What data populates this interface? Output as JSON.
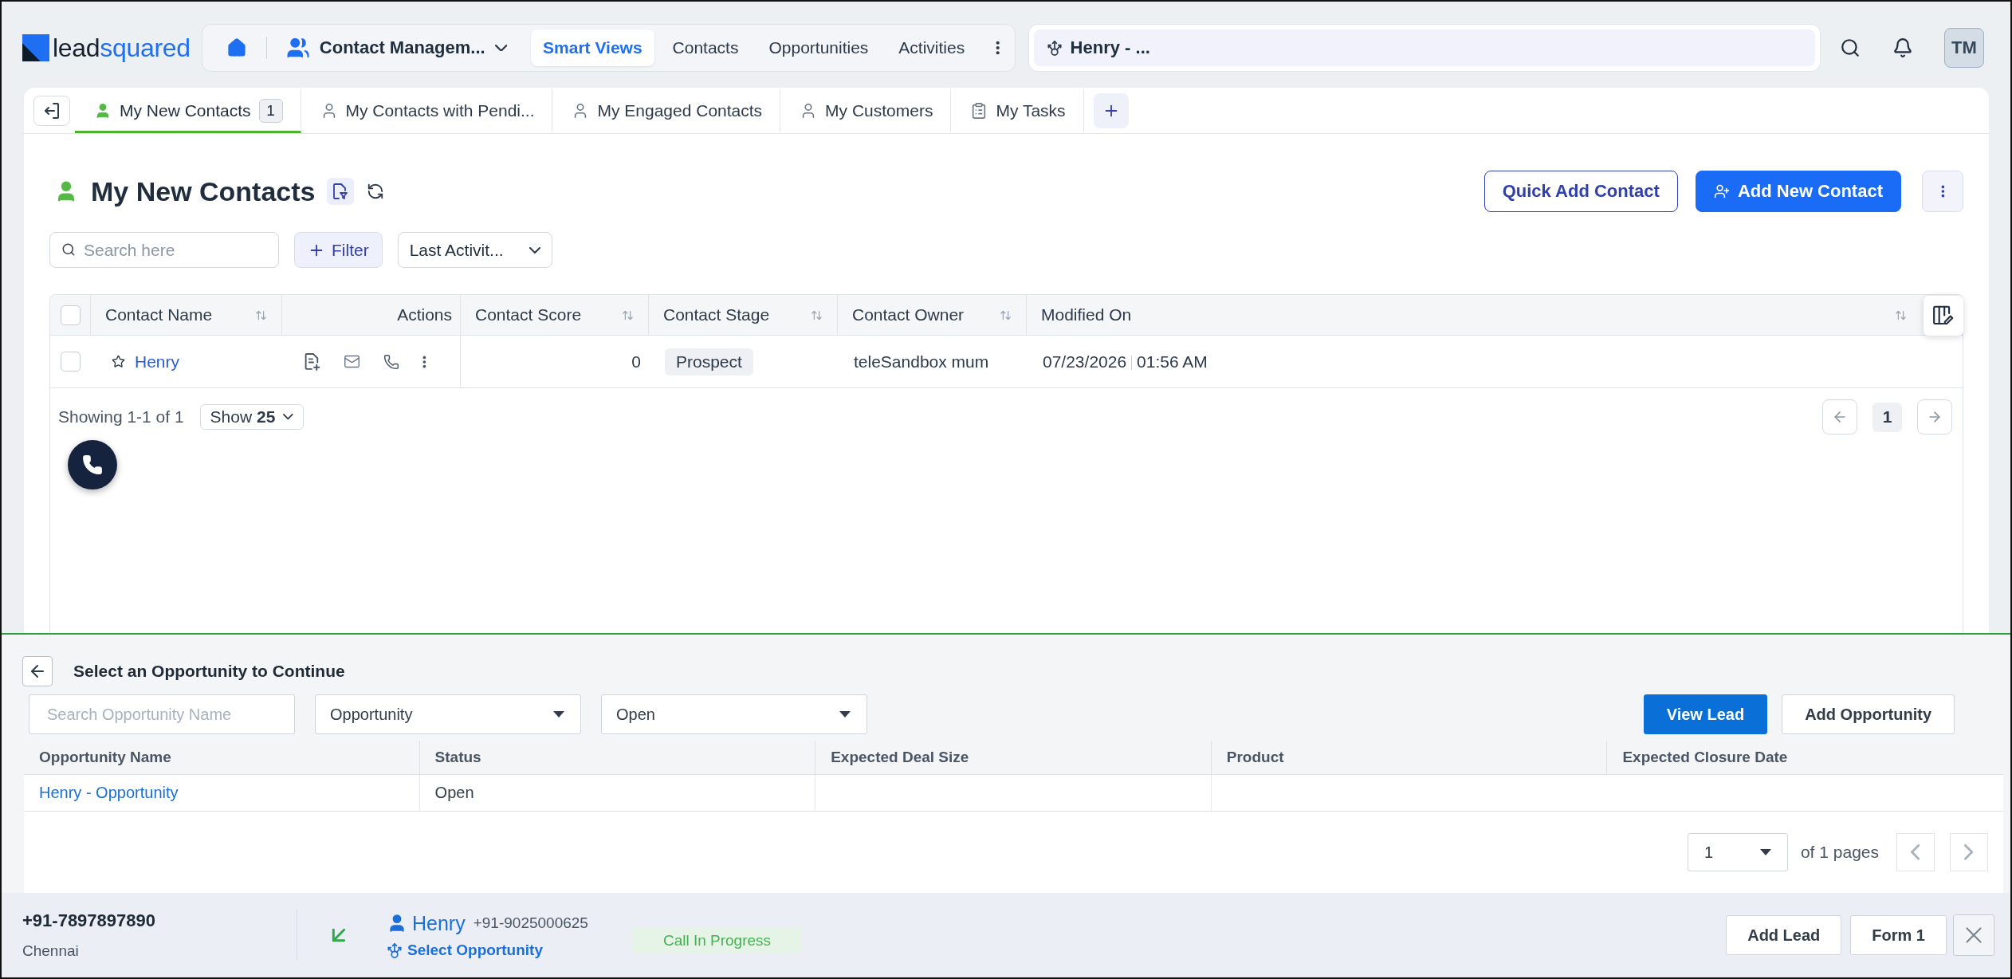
{
  "top_bar": {
    "logo": [
      "lead",
      "squared"
    ],
    "app_switcher": "Contact Managem...",
    "nav": [
      {
        "label": "Smart Views",
        "selected": true
      },
      {
        "label": "Contacts",
        "selected": false
      },
      {
        "label": "Opportunities",
        "selected": false
      },
      {
        "label": "Activities",
        "selected": false
      }
    ],
    "record_field": "Henry - ...",
    "avatar": "TM"
  },
  "tabs": {
    "items": [
      {
        "label": "My New Contacts",
        "count": "1",
        "kind": "contacts",
        "selected": true
      },
      {
        "label": "My Contacts with Pendi...",
        "kind": "contacts",
        "selected": false
      },
      {
        "label": "My Engaged Contacts",
        "kind": "contacts",
        "selected": false
      },
      {
        "label": "My Customers",
        "kind": "contacts",
        "selected": false
      },
      {
        "label": "My Tasks",
        "kind": "tasks",
        "selected": false
      }
    ]
  },
  "view": {
    "title": "My New Contacts",
    "buttons": [
      {
        "label": "Quick Add Contact",
        "kind": "outline"
      },
      {
        "label": "Add New Contact",
        "kind": "primary"
      }
    ],
    "search": {
      "placeholder": "Search here"
    },
    "filter": "Filter",
    "sort": "Last Activit..."
  },
  "contacts_table": {
    "all_checked": false,
    "columns": [
      {
        "label": "Contact Name",
        "kind": "text",
        "sortable": true
      },
      {
        "label": "Actions",
        "kind": "actions",
        "sortable": false
      },
      {
        "label": "Contact Score",
        "kind": "text",
        "sortable": true
      },
      {
        "label": "Contact Stage",
        "kind": "text",
        "sortable": true
      },
      {
        "label": "Contact Owner",
        "kind": "text",
        "sortable": true
      },
      {
        "label": "Modified On",
        "kind": "text",
        "sortable": true
      }
    ],
    "rows": [
      {
        "checked": false,
        "starred": false,
        "name": "Henry",
        "score": "0",
        "stage": "Prospect",
        "owner": "teleSandbox mum",
        "modified_date": "07/23/2026",
        "modified_time": "01:56 AM"
      }
    ],
    "footer": {
      "summary": "Showing 1-1 of 1",
      "page_size": "Show **25**",
      "pages": [
        {
          "label": "1",
          "selected": true
        }
      ]
    }
  },
  "opportunity_panel": {
    "title": "Select an Opportunity to Continue",
    "search": {
      "placeholder": "Search Opportunity Name"
    },
    "selects": [
      "Opportunity",
      "Open"
    ],
    "buttons": [
      {
        "label": "View Lead",
        "kind": "primary"
      },
      {
        "label": "Add Opportunity",
        "kind": "secondary"
      }
    ],
    "table": {
      "columns": [
        "Opportunity Name",
        "Status",
        "Expected Deal Size",
        "Product",
        "Expected Closure Date"
      ],
      "rows": [
        {
          "name": "Henry - Opportunity",
          "status": "Open"
        }
      ]
    },
    "pager": {
      "page": "1",
      "total": "of 1 pages"
    }
  },
  "call_bar": {
    "number": "+91-7897897890",
    "location": "Chennai",
    "incoming": true,
    "contact": {
      "name": "Henry",
      "number": "+91-9025000625",
      "link": "Select Opportunity"
    },
    "status": "Call In Progress",
    "buttons": [
      "Add Lead",
      "Form 1"
    ]
  }
}
